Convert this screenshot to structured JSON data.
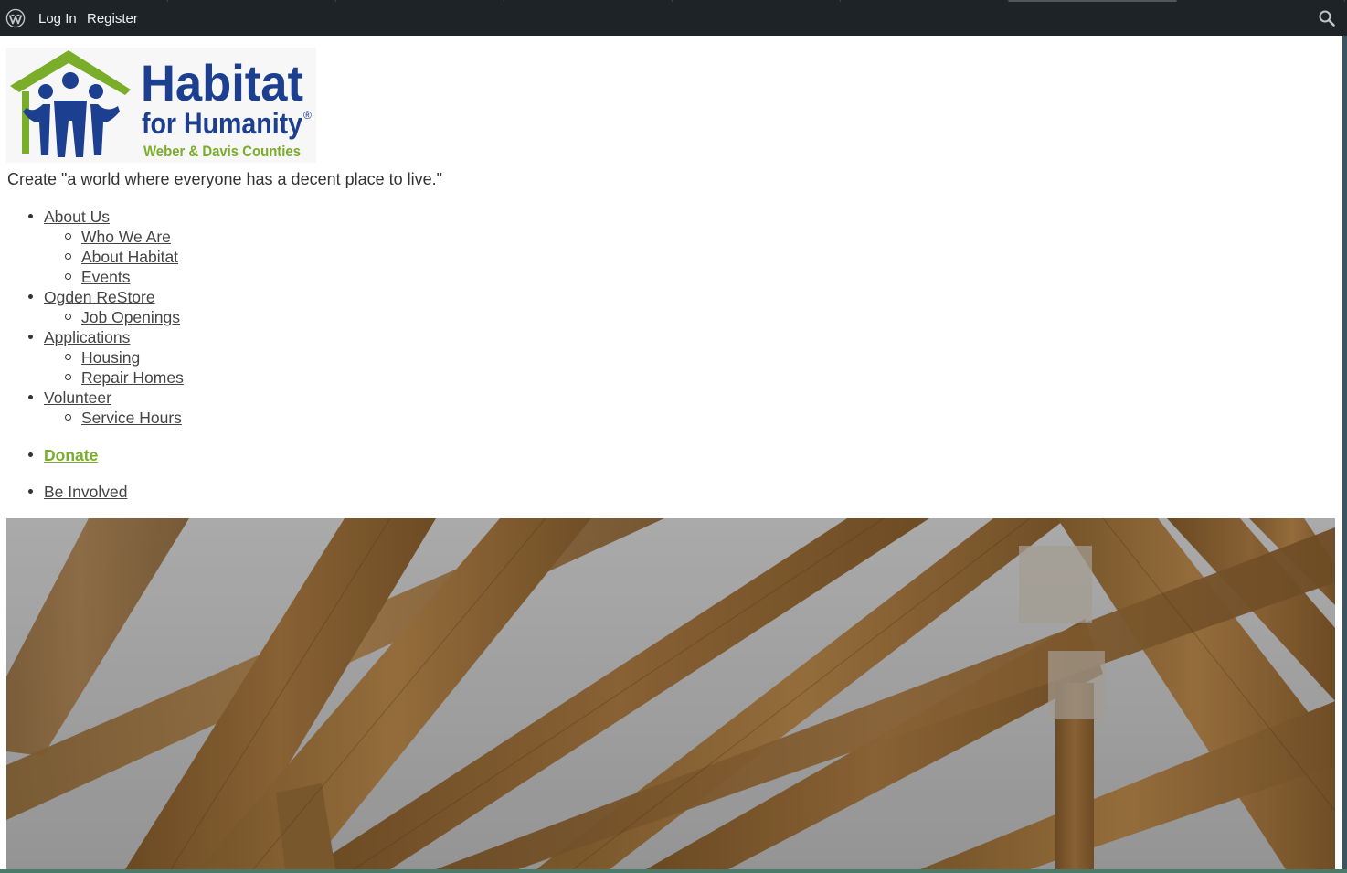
{
  "adminbar": {
    "login_label": "Log In",
    "register_label": "Register",
    "wp_icon": "wordpress-icon",
    "search_icon": "search-icon",
    "background": "#1d2327"
  },
  "site": {
    "logo": {
      "title": "Habitat",
      "subtitle": "for Humanity",
      "registered": "®",
      "region": "Weber & Davis Counties",
      "brand_blue": "#1d3f8f",
      "brand_green": "#7aad2a"
    },
    "tagline": "Create \"a world where everyone has a decent place to live.\""
  },
  "nav": {
    "about": {
      "label": "About Us",
      "children": [
        "Who We Are",
        "About Habitat",
        "Events"
      ]
    },
    "restore": {
      "label": "Ogden ReStore",
      "children": [
        "Job Openings"
      ]
    },
    "applications": {
      "label": "Applications",
      "children": [
        "Housing",
        "Repair Homes"
      ]
    },
    "volunteer": {
      "label": "Volunteer",
      "children": [
        "Service Hours"
      ]
    },
    "donate": {
      "label": "Donate",
      "color": "#7aad2a"
    },
    "involved": {
      "label": "Be Involved"
    }
  }
}
